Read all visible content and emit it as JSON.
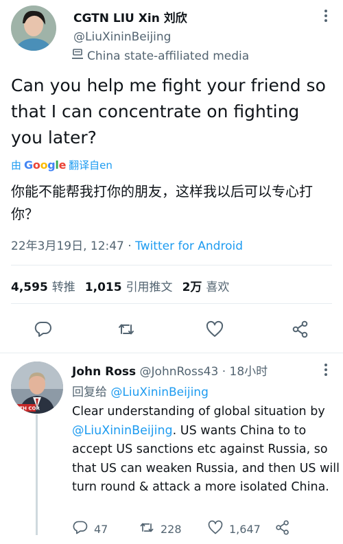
{
  "tweet": {
    "display_name": "CGTN LIU Xin 刘欣",
    "handle": "@LiuXininBeijing",
    "affiliation_label": "China state-affiliated media",
    "text": "Can you help me fight your friend so that I can concentrate on fighting you later?",
    "translation_prefix": "由",
    "translation_provider": "Google",
    "translation_suffix": "翻译自en",
    "translated_text": "你能不能帮我打你的朋友，这样我以后可以专心打你？",
    "timestamp": "22年3月19日, 12:47",
    "dot": " · ",
    "source": "Twitter for Android",
    "stats": {
      "retweets_count": "4,595",
      "retweets_label": "转推",
      "quotes_count": "1,015",
      "quotes_label": "引用推文",
      "likes_count": "2万",
      "likes_label": "喜欢"
    },
    "actions": [
      "reply-icon",
      "retweet-icon",
      "like-icon",
      "share-icon"
    ]
  },
  "reply": {
    "display_name": "John Ross",
    "handle": "@JohnRoss43",
    "time": " · 18小时",
    "replying_to_label": "回复给 ",
    "replying_to_handle": "@LiuXininBeijing",
    "text_part1": "Clear understanding of global situation by ",
    "mention": "@LiuXininBeijing",
    "text_part2": ". US wants China to to accept US sanctions etc against Russia, so that US can weaken Russia, and then US will turn round & attack a more isolated China.",
    "avatar_caption": "WITH COR",
    "replies_count": "47",
    "retweets_count": "228",
    "likes_count": "1,647"
  },
  "colors": {
    "link": "#1d9bf0",
    "secondary": "#536471",
    "text": "#0f1419"
  }
}
